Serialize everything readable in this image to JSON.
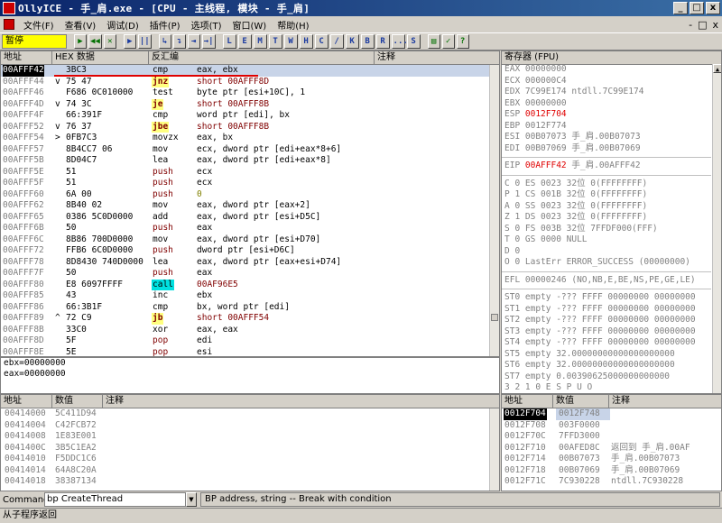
{
  "window": {
    "title": "OllyICE - 手_肩.exe - [CPU - 主线程, 模块 - 手_肩]",
    "controls": [
      "_",
      "□",
      "x"
    ]
  },
  "menu": {
    "items": [
      "文件(F)",
      "查看(V)",
      "调试(D)",
      "插件(P)",
      "选项(T)",
      "窗口(W)",
      "帮助(H)"
    ],
    "mdi_controls": [
      "-",
      "□",
      "x"
    ]
  },
  "toolbar": {
    "status": "暂停",
    "buttons": [
      "▶",
      "◀◀",
      "✕",
      "▶",
      "||",
      "↳",
      "↴",
      "⇥",
      "→|"
    ],
    "letters": [
      "L",
      "E",
      "M",
      "T",
      "W",
      "H",
      "C",
      "/",
      "K",
      "B",
      "R",
      "...",
      "S"
    ],
    "right_buttons": [
      "▤",
      "✓",
      "?"
    ]
  },
  "disasm": {
    "headers": [
      "地址",
      "HEX 数据",
      "反汇编",
      "注释"
    ],
    "rows": [
      {
        "addr": "00AFFF42",
        "hex": "3BC3",
        "mnem": "cmp",
        "args": "eax, ebx",
        "sel": true
      },
      {
        "addr": "00AFFF44",
        "mark": "v",
        "hex": "75 47",
        "mnem": "jnz",
        "args": "short 00AFFF8D",
        "style": "jump"
      },
      {
        "addr": "00AFFF46",
        "hex": "F686 0C010000",
        "mnem": "test",
        "args": "byte ptr [esi+10C], 1"
      },
      {
        "addr": "00AFFF4D",
        "mark": "v",
        "hex": "74 3C",
        "mnem": "je",
        "args": "short 00AFFF8B",
        "style": "jump"
      },
      {
        "addr": "00AFFF4F",
        "hex": "66:391F",
        "mnem": "cmp",
        "args": "word ptr [edi], bx"
      },
      {
        "addr": "00AFFF52",
        "mark": "v",
        "hex": "76 37",
        "mnem": "jbe",
        "args": "short 00AFFF8B",
        "style": "jump"
      },
      {
        "addr": "00AFFF54",
        "mark": ">",
        "hex": "0FB7C3",
        "mnem": "movzx",
        "args": "eax, bx"
      },
      {
        "addr": "00AFFF57",
        "hex": "8B4CC7 06",
        "mnem": "mov",
        "args": "ecx, dword ptr [edi+eax*8+6]"
      },
      {
        "addr": "00AFFF5B",
        "hex": "8D04C7",
        "mnem": "lea",
        "args": "eax, dword ptr [edi+eax*8]"
      },
      {
        "addr": "00AFFF5E",
        "hex": "51",
        "mnem": "push",
        "args": "ecx",
        "style": "push"
      },
      {
        "addr": "00AFFF5F",
        "hex": "51",
        "mnem": "push",
        "args": "ecx",
        "style": "push"
      },
      {
        "addr": "00AFFF60",
        "hex": "6A 00",
        "mnem": "push",
        "args": "0",
        "style": "push-imm"
      },
      {
        "addr": "00AFFF62",
        "hex": "8B40 02",
        "mnem": "mov",
        "args": "eax, dword ptr [eax+2]"
      },
      {
        "addr": "00AFFF65",
        "hex": "0386 5C0D0000",
        "mnem": "add",
        "args": "eax, dword ptr [esi+D5C]"
      },
      {
        "addr": "00AFFF6B",
        "hex": "50",
        "mnem": "push",
        "args": "eax",
        "style": "push"
      },
      {
        "addr": "00AFFF6C",
        "hex": "8B86 700D0000",
        "mnem": "mov",
        "args": "eax, dword ptr [esi+D70]"
      },
      {
        "addr": "00AFFF72",
        "hex": "FFB6 6C0D0000",
        "mnem": "push",
        "args": "dword ptr [esi+D6C]",
        "style": "push"
      },
      {
        "addr": "00AFFF78",
        "hex": "8D8430 740D0000",
        "mnem": "lea",
        "args": "eax, dword ptr [eax+esi+D74]"
      },
      {
        "addr": "00AFFF7F",
        "hex": "50",
        "mnem": "push",
        "args": "eax",
        "style": "push"
      },
      {
        "addr": "00AFFF80",
        "hex": "E8 6097FFFF",
        "mnem": "call",
        "args": "00AF96E5",
        "style": "call"
      },
      {
        "addr": "00AFFF85",
        "hex": "43",
        "mnem": "inc",
        "args": "ebx"
      },
      {
        "addr": "00AFFF86",
        "hex": "66:3B1F",
        "mnem": "cmp",
        "args": "bx, word ptr [edi]"
      },
      {
        "addr": "00AFFF89",
        "mark": "^",
        "hex": "72 C9",
        "mnem": "jb",
        "args": "short 00AFFF54",
        "style": "jump"
      },
      {
        "addr": "00AFFF8B",
        "hex": "33C0",
        "mnem": "xor",
        "args": "eax, eax"
      },
      {
        "addr": "00AFFF8D",
        "hex": "5F",
        "mnem": "pop",
        "args": "edi",
        "style": "push"
      },
      {
        "addr": "00AFFF8E",
        "hex": "5E",
        "mnem": "pop",
        "args": "esi",
        "style": "push"
      }
    ]
  },
  "info": {
    "lines": [
      "ebx=00000000",
      "eax=00000000"
    ]
  },
  "registers": {
    "header": "寄存器 (FPU)",
    "lines": [
      {
        "text": "EAX 00000000"
      },
      {
        "text": "ECX 000000C4"
      },
      {
        "text": "EDX 7C99E174 ntdll.7C99E174"
      },
      {
        "text": "EBX 00000000"
      },
      {
        "text": "ESP 0012F704",
        "red": "0012F704",
        "prefix": "ESP "
      },
      {
        "text": "EBP 0012F774"
      },
      {
        "text": "ESI 00B07073 手_肩.00B07073"
      },
      {
        "text": "EDI 00B07069 手_肩.00B07069"
      },
      {
        "gap": true
      },
      {
        "text": "EIP 00AFFF42 手_肩.00AFFF42",
        "red": "00AFFF42",
        "prefix": "EIP ",
        "suffix": " 手_肩.00AFFF42"
      },
      {
        "gap": true
      },
      {
        "text": "C 0  ES 0023 32位 0(FFFFFFFF)"
      },
      {
        "text": "P 1  CS 001B 32位 0(FFFFFFFF)"
      },
      {
        "text": "A 0  SS 0023 32位 0(FFFFFFFF)"
      },
      {
        "text": "Z 1  DS 0023 32位 0(FFFFFFFF)"
      },
      {
        "text": "S 0  FS 003B 32位 7FFDF000(FFF)"
      },
      {
        "text": "T 0  GS 0000 NULL"
      },
      {
        "text": "D 0"
      },
      {
        "text": "O 0  LastErr ERROR_SUCCESS (00000000)"
      },
      {
        "gap": true
      },
      {
        "text": "EFL 00000246 (NO,NB,E,BE,NS,PE,GE,LE)"
      },
      {
        "gap": true
      },
      {
        "text": "ST0 empty -??? FFFF 00000000 00000000"
      },
      {
        "text": "ST1 empty -??? FFFF 00000000 00000000"
      },
      {
        "text": "ST2 empty -??? FFFF 00000000 00000000"
      },
      {
        "text": "ST3 empty -??? FFFF 00000000 00000000"
      },
      {
        "text": "ST4 empty -??? FFFF 00000000 00000000"
      },
      {
        "text": "ST5 empty 32.00000000000000000000"
      },
      {
        "text": "ST6 empty 32.00000000000000000000"
      },
      {
        "text": "ST7 empty 0.00390625000000000000"
      },
      {
        "text": "                3 2 1 0      E S P U O"
      }
    ]
  },
  "dump": {
    "headers": [
      "地址",
      "数值",
      "注释"
    ],
    "rows": [
      {
        "addr": "00414000",
        "val": "5C411D94"
      },
      {
        "addr": "00414004",
        "val": "C42FCB72"
      },
      {
        "addr": "00414008",
        "val": "1E83E001"
      },
      {
        "addr": "0041400C",
        "val": "3B5C1EA2"
      },
      {
        "addr": "00414010",
        "val": "F5DDC1C6"
      },
      {
        "addr": "00414014",
        "val": "64A8C20A"
      },
      {
        "addr": "00414018",
        "val": "38387134"
      }
    ]
  },
  "stack": {
    "headers": [
      "地址",
      "数值",
      "注释"
    ],
    "rows": [
      {
        "addr": "0012F704",
        "val": "0012F748",
        "comment": "",
        "sel": true
      },
      {
        "addr": "0012F708",
        "val": "003F0000",
        "comment": ""
      },
      {
        "addr": "0012F70C",
        "val": "7FFD3000",
        "comment": ""
      },
      {
        "addr": "0012F710",
        "val": "00AFED8C",
        "comment": "返回到 手_肩.00AF"
      },
      {
        "addr": "0012F714",
        "val": "00B07073",
        "comment": "手_肩.00B07073"
      },
      {
        "addr": "0012F718",
        "val": "00B07069",
        "comment": "手_肩.00B07069"
      },
      {
        "addr": "0012F71C",
        "val": "7C930228",
        "comment": "ntdll.7C930228"
      }
    ]
  },
  "command": {
    "label": "Command",
    "value": "bp CreateThread",
    "hint": "BP address, string -- Break with condition"
  },
  "status": {
    "text": "从子程序返回"
  },
  "colors": {
    "title_start": "#0a246a",
    "title_end": "#3a6ea5",
    "highlight": "#e00000",
    "underline": "#e00000"
  }
}
